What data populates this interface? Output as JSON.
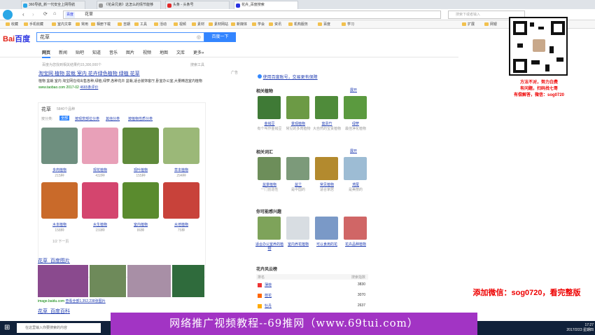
{
  "browser": {
    "tabs": [
      {
        "label": "360导航_新一代安全上网导航",
        "color": "#2aa7e6"
      },
      {
        "label": "《花朵兄弟》这怎么的情节能够",
        "color": "#999999"
      },
      {
        "label": "头条 - 头条号",
        "color": "#e22929"
      },
      {
        "label": "花卉_百度搜索",
        "color": "#2932e1",
        "active": true
      }
    ],
    "url": "花草",
    "url_tag": "百度",
    "search_placeholder": "搜索下或者输入",
    "bookmarks": [
      "收藏",
      "手机收藏",
      "室内文章",
      "常用",
      "相册下载",
      "吉期",
      "工具",
      "活动",
      "视频",
      "素材",
      "素材网站",
      "新媒体",
      "学会",
      "资讯",
      "机构服务",
      "百度",
      "学习"
    ],
    "right_tools": [
      "扩展",
      "网银"
    ]
  },
  "baidu": {
    "logo_left": "Bai",
    "logo_right": "百度",
    "query": "花草",
    "search_button": "百度一下",
    "tabs": [
      "网页",
      "新闻",
      "贴吧",
      "知道",
      "音乐",
      "图片",
      "视频",
      "地图",
      "文库",
      "更多»"
    ],
    "tools": "搜索工具",
    "result_count": "百度为您找到相关结果约15,300,000个",
    "ad": {
      "title": "淘宝网 植物 盆栽 室内 花卉绿色植物 绿植 花草",
      "desc": "植物 盆栽 室内 淘宝网在线出售各种,绿植,绿萝,各种花卉 盆栽,适合装饰客厅,卧室办公室,大量精选室内植物",
      "url": "www.taobao.com 2017-02",
      "rating": "4665条评价",
      "tag": "广告"
    },
    "flower_section": {
      "title": "花草",
      "subtitle": "5840个品种",
      "filters": [
        "按分类:",
        "全部",
        "按观赏部位分类",
        "其他分类",
        "按植物性质分类"
      ],
      "items": [
        {
          "name": "多肉植物",
          "count": "215种",
          "color": "#6e8f7f"
        },
        {
          "name": "观花植物",
          "count": "432种",
          "color": "#e8a0b8"
        },
        {
          "name": "观叶植物",
          "count": "155种",
          "color": "#5f8a3a"
        },
        {
          "name": "草本植物",
          "count": "294种",
          "color": "#9bb878"
        },
        {
          "name": "木本植物",
          "count": "158种",
          "color": "#c96a2a"
        },
        {
          "name": "水生植物",
          "count": "159种",
          "color": "#d4456e"
        },
        {
          "name": "室内植物",
          "count": "86种",
          "color": "#5a8b2e"
        },
        {
          "name": "水培植物",
          "count": "75种",
          "color": "#c8423a"
        }
      ],
      "pager": "1/2 下一页",
      "report": "反馈"
    },
    "images": {
      "title": "花草_百度图片",
      "url": "image.baidu.com",
      "more": "查看全部1,352,238张图片"
    },
    "baike": "花草_百度百科"
  },
  "side": {
    "brand_link": "使用百度账号，交易更有保障",
    "related_plants": {
      "title": "相关植物",
      "more": "展开",
      "items": [
        {
          "name": "金钱豆",
          "desc": "有个叫作金钱豆",
          "color": "#3f7a36"
        },
        {
          "name": "景观植物",
          "desc": "常见的多肉植物",
          "color": "#6c9a45"
        },
        {
          "name": "富贵竹",
          "desc": "大自然的宝贵植物",
          "color": "#4f8b3a"
        },
        {
          "name": "绿萝",
          "desc": "最佳净化植物",
          "color": "#5b9a3f"
        }
      ]
    },
    "related_words": {
      "title": "相关词汇",
      "more": "展开",
      "items": [
        {
          "name": "盆景植物",
          "desc": "一门创造性",
          "color": "#6d8e5a"
        },
        {
          "name": "盆兰",
          "desc": "是中国的",
          "color": "#7c9a7a"
        },
        {
          "name": "常见植物",
          "desc": "适合家居",
          "color": "#b38a2e"
        },
        {
          "name": "鸢尾",
          "desc": "是美丽的",
          "color": "#9dbcd4"
        }
      ]
    },
    "interest": {
      "title": "你可能感兴趣",
      "items": [
        {
          "name": "适合办公室养的植物",
          "color": "#7ea35a"
        },
        {
          "name": "室内养花植物",
          "color": "#d8dde2"
        },
        {
          "name": "可以食用的花",
          "color": "#7a99c7"
        },
        {
          "name": "花卉品种植物",
          "color": "#d06666"
        }
      ]
    },
    "ranking": {
      "title": "花卉风云榜",
      "col1": "排名",
      "col2": "搜索指数",
      "rows": [
        {
          "name": "薄荷",
          "value": "3830"
        },
        {
          "name": "桂花",
          "value": "3070"
        },
        {
          "name": "牡丹",
          "value": "2637"
        }
      ]
    }
  },
  "overlay": {
    "promo": [
      "方法不对，努力白费",
      "有问题，扫码找七哥",
      "有偿解答，微信：sog0720"
    ],
    "wechat": "添加微信：sog0720，看完整版",
    "banner": "网络推广视频教程--69推网（www.69tui.com）"
  },
  "taskbar": {
    "search_placeholder": "在这里输入你要搜索的内容",
    "time": "17:27",
    "date": "2017/2/23 星期四"
  }
}
